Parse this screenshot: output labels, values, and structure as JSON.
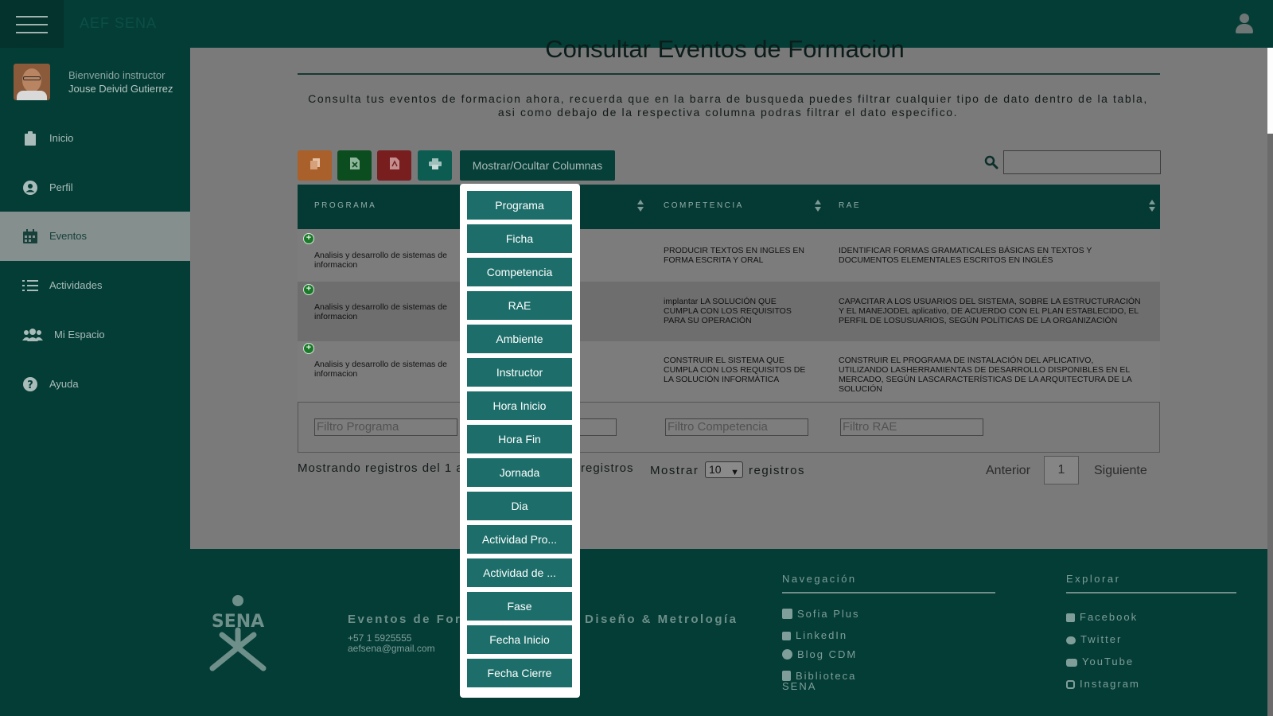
{
  "app": {
    "brand": "AEF SENA"
  },
  "user": {
    "greeting": "Bienvenido instructor",
    "name": "Jouse Deivid Gutierrez"
  },
  "sidebar": {
    "items": [
      {
        "label": "Inicio",
        "icon": "clipboard-icon"
      },
      {
        "label": "Perfil",
        "icon": "user-circle-icon"
      },
      {
        "label": "Eventos",
        "icon": "calendar-icon",
        "active": true
      },
      {
        "label": "Actividades",
        "icon": "tasks-icon"
      },
      {
        "label": "Mi Espacio",
        "icon": "users-icon"
      },
      {
        "label": "Ayuda",
        "icon": "question-circle-icon"
      }
    ]
  },
  "main": {
    "title": "Consultar Eventos de Formacion",
    "intro": "Consulta tus eventos de formacion ahora, recuerda que en la barra de busqueda puedes filtrar cualquier tipo de dato dentro de la tabla, asi como debajo de la respectiva columna podras filtrar el dato especifico.",
    "toolbar": {
      "column_visibility": "Mostrar/Ocultar Columnas"
    },
    "search": {
      "value": ""
    }
  },
  "table": {
    "headers": [
      "PROGRAMA",
      "COMPETENCIA",
      "RAE"
    ],
    "rows": [
      {
        "programa": "Analisis y desarrollo de sistemas de informacion",
        "competencia": "PRODUCIR TEXTOS EN INGLES EN FORMA ESCRITA Y ORAL",
        "rae": "IDENTIFICAR FORMAS GRAMATICALES BÁSICAS EN TEXTOS Y DOCUMENTOS ELEMENTALES ESCRITOS EN INGLÉS"
      },
      {
        "programa": "Analisis y desarrollo de sistemas de informacion",
        "competencia": "implantar LA SOLUCIÓN QUE CUMPLA CON LOS REQUISITOS PARA SU OPERACIÓN",
        "rae": "CAPACITAR A LOS USUARIOS DEL SISTEMA, SOBRE LA ESTRUCTURACIÓN Y EL MANEJODEL aplicativo, DE ACUERDO CON EL PLAN ESTABLECIDO, EL PERFIL DE LOSUSUARIOS, SEGÚN POLÍTICAS DE LA ORGANIZACIÓN"
      },
      {
        "programa": "Analisis y desarrollo de sistemas de informacion",
        "competencia": "CONSTRUIR EL SISTEMA QUE CUMPLA CON LOS REQUISITOS DE LA SOLUCIÓN INFORMÁTICA",
        "rae": "CONSTRUIR EL PROGRAMA DE INSTALACIÓN DEL APLICATIVO, UTILIZANDO LASHERRAMIENTAS DE DESARROLLO DISPONIBLES EN EL MERCADO, SEGÚN LASCARACTERÍSTICAS DE LA ARQUITECTURA DE LA SOLUCIÓN"
      }
    ],
    "filters": {
      "programa": "Filtro Programa",
      "competencia": "Filtro Competencia",
      "rae": "Filtro RAE"
    },
    "info_left": "Mostrando registros del 1 a",
    "info_right": "registros",
    "show_label": "Mostrar",
    "show_value": "10",
    "show_suffix": "registros",
    "pagination": {
      "prev": "Anterior",
      "page": "1",
      "next": "Siguiente"
    }
  },
  "column_menu": {
    "items": [
      "Programa",
      "Ficha",
      "Competencia",
      "RAE",
      "Ambiente",
      "Instructor",
      "Hora Inicio",
      "Hora Fin",
      "Jornada",
      "Dia",
      "Actividad Pro...",
      "Actividad de ...",
      "Fase",
      "Fecha Inicio",
      "Fecha Cierre"
    ]
  },
  "footer": {
    "title_left": "Eventos de Forr",
    "title_right": "Diseño & Metrología",
    "phone": "+57 1 5925555",
    "email": "aefsena@gmail.com",
    "nav_heading": "Navegación",
    "nav_links": [
      "Sofia Plus",
      "LinkedIn",
      "Blog CDM",
      "Biblioteca",
      "SENA"
    ],
    "explore_heading": "Explorar",
    "explore_links": [
      "Facebook",
      "Twitter",
      "YouTube",
      "Instagram"
    ]
  },
  "colors": {
    "brand_dark": "#043d36",
    "menu_button": "#1d6e6a",
    "copy_button": "#a9602a",
    "excel_button": "#0b4d1f",
    "pdf_button": "#781e1e",
    "print_button": "#0c5c52"
  }
}
